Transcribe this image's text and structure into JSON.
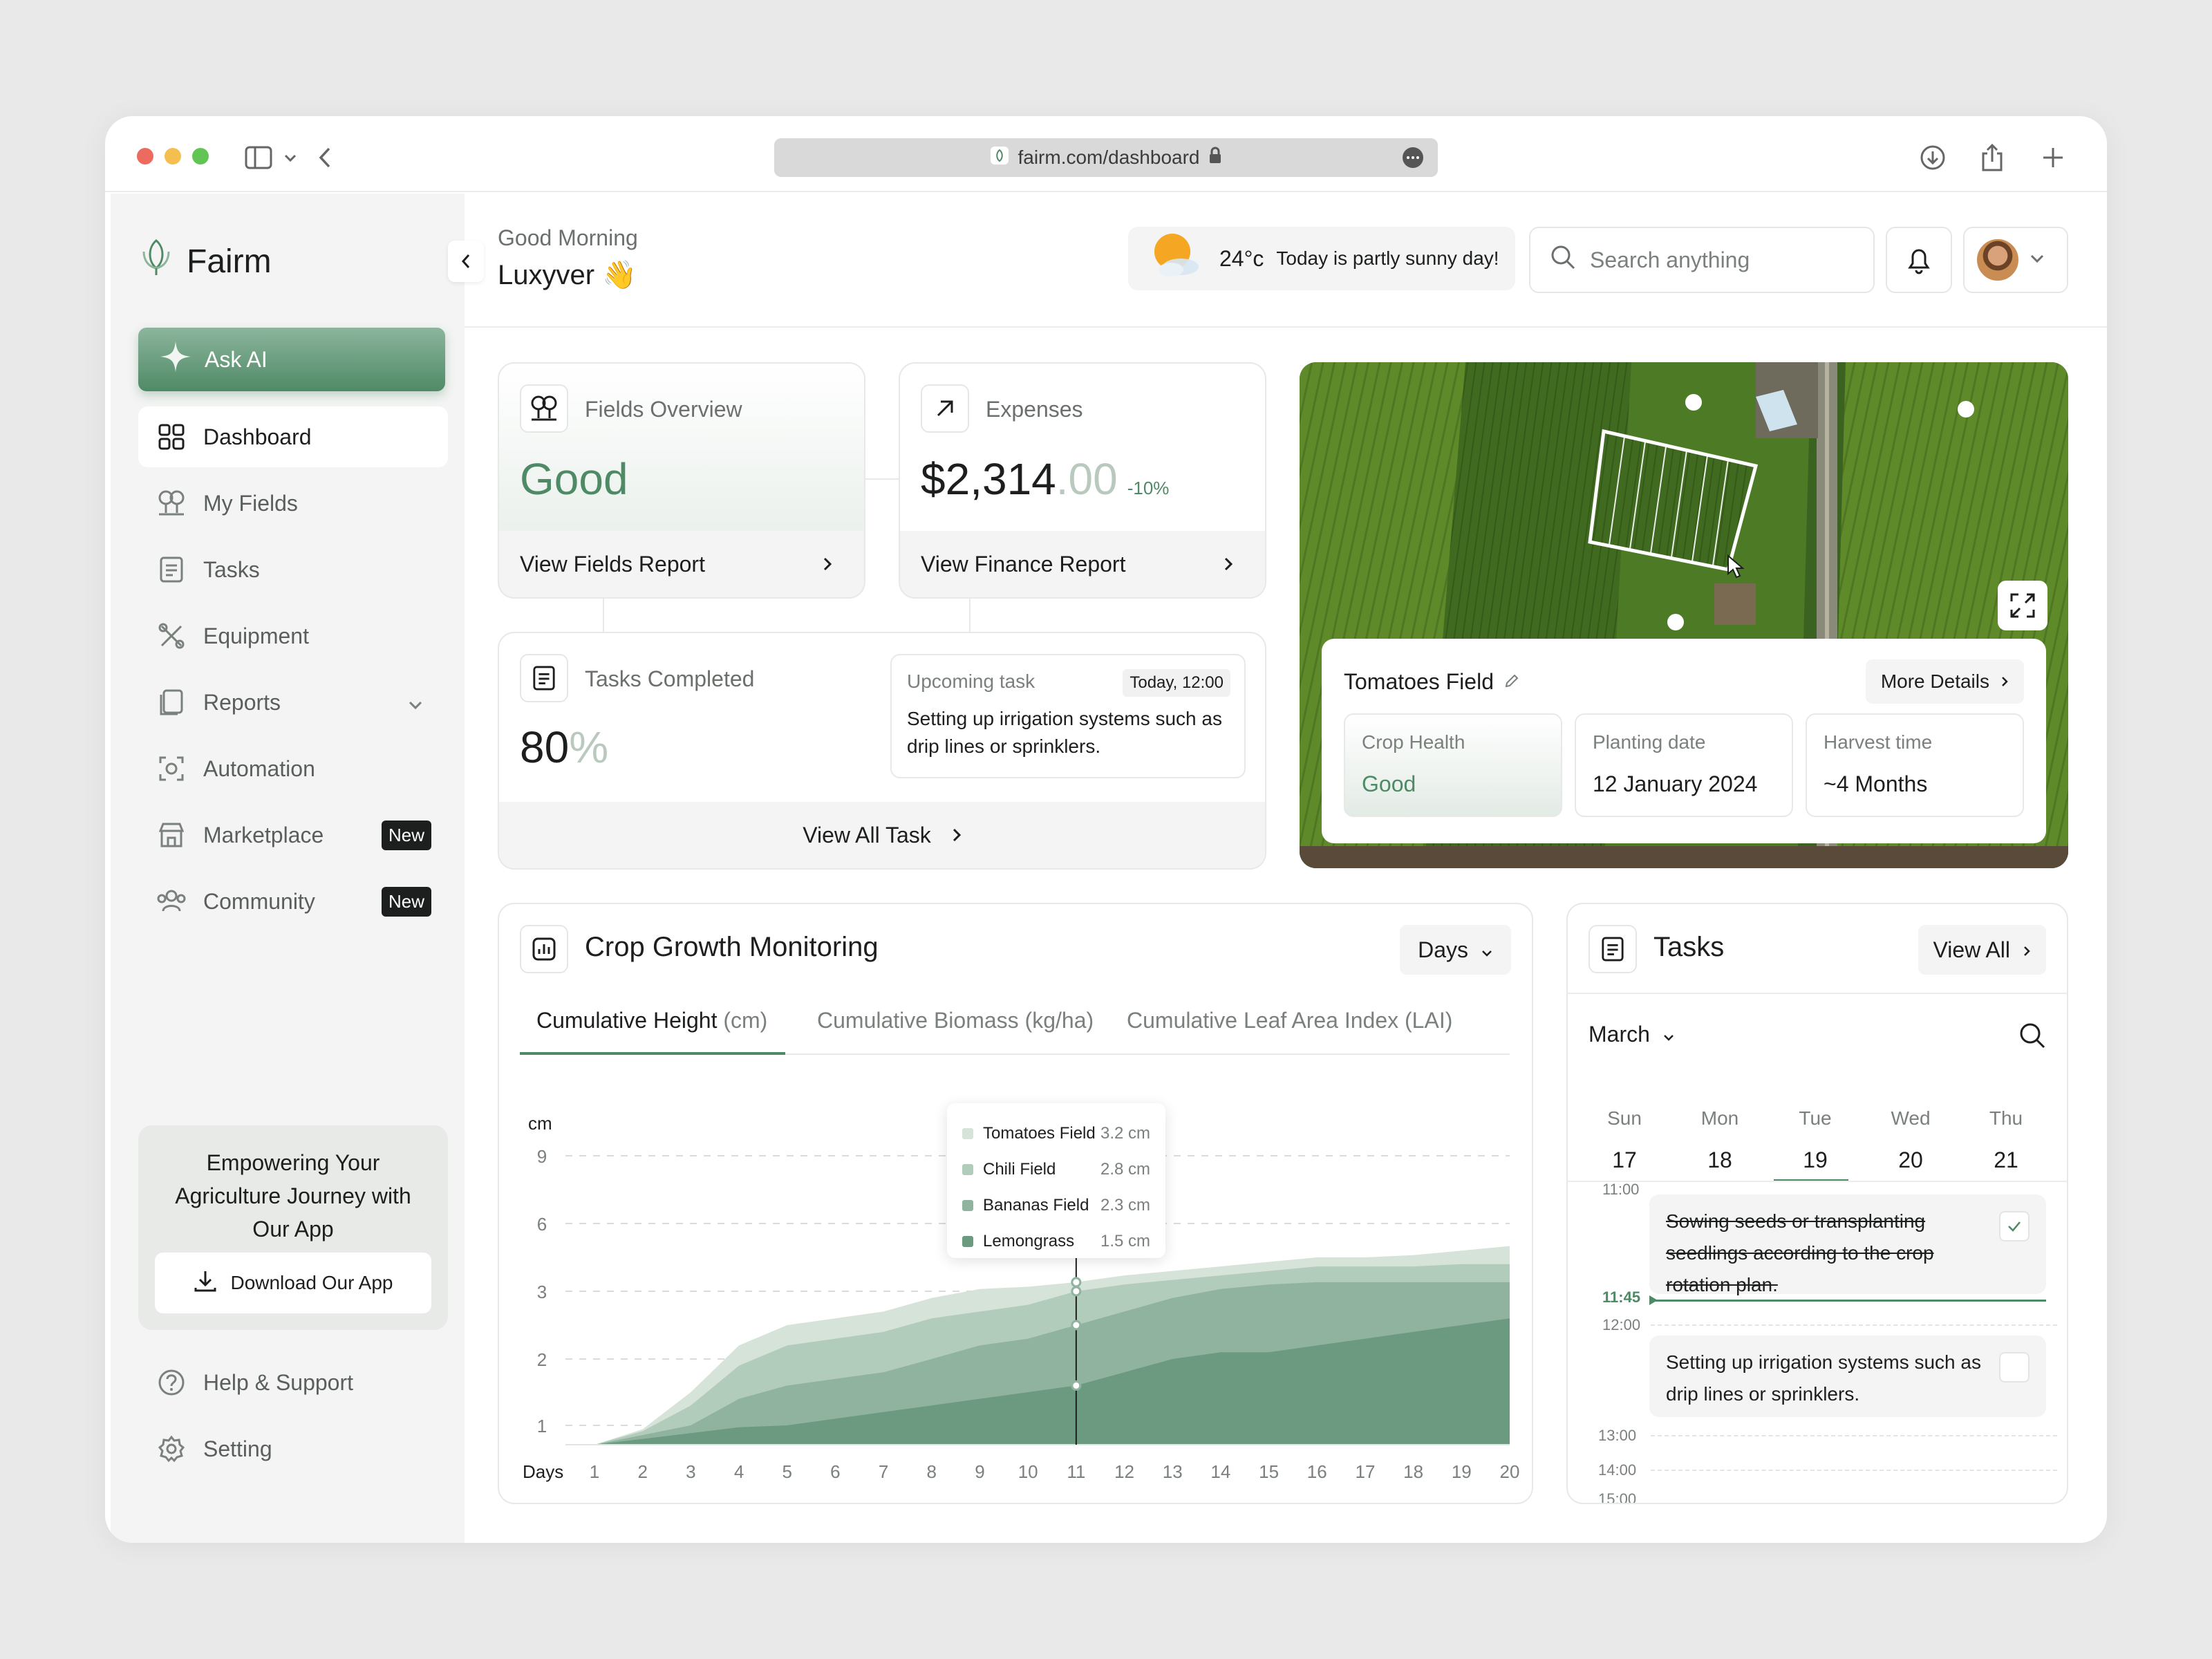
{
  "browser": {
    "url": "fairm.com/dashboard",
    "traffic_colors": [
      "#ed6a5e",
      "#f5bf4f",
      "#61c554"
    ]
  },
  "sidebar": {
    "brand": "Fairm",
    "ask_ai": "Ask AI",
    "items": [
      {
        "label": "Dashboard",
        "icon": "grid-icon",
        "active": true
      },
      {
        "label": "My Fields",
        "icon": "trees-icon"
      },
      {
        "label": "Tasks",
        "icon": "clipboard-icon"
      },
      {
        "label": "Equipment",
        "icon": "tools-icon"
      },
      {
        "label": "Reports",
        "icon": "reports-icon"
      },
      {
        "label": "Automation",
        "icon": "automation-icon"
      },
      {
        "label": "Marketplace",
        "icon": "store-icon",
        "badge": "New"
      },
      {
        "label": "Community",
        "icon": "users-icon",
        "badge": "New"
      }
    ],
    "promo": {
      "line1": "Empowering Your",
      "line2": "Agriculture Journey with",
      "line3": "Our App",
      "button": "Download Our App"
    },
    "help": "Help & Support",
    "setting": "Setting"
  },
  "header": {
    "greeting": "Good Morning",
    "name": "Luxyver 👋",
    "temperature": "24°c",
    "weather_text": "Today is partly sunny day!",
    "search_placeholder": "Search anything"
  },
  "fields_overview": {
    "title": "Fields Overview",
    "status": "Good",
    "link": "View Fields Report"
  },
  "expenses": {
    "title": "Expenses",
    "amount_main": "$2,314",
    "amount_cents": ".00",
    "change": "-10%",
    "link": "View Finance Report"
  },
  "tasks_completed": {
    "title": "Tasks Completed",
    "percent": "80",
    "percent_sign": "%",
    "upcoming_label": "Upcoming task",
    "upcoming_time": "Today, 12:00",
    "upcoming_text": "Setting up irrigation systems such as drip lines or sprinklers.",
    "link": "View All Task"
  },
  "field_detail": {
    "name": "Tomatoes Field",
    "more": "More Details",
    "crop_health_label": "Crop Health",
    "crop_health_value": "Good",
    "planting_label": "Planting date",
    "planting_value": "12 January 2024",
    "harvest_label": "Harvest time",
    "harvest_value": "~4 Months"
  },
  "crop_growth": {
    "title": "Crop Growth Monitoring",
    "period": "Days",
    "tabs": [
      {
        "label": "Cumulative Height",
        "unit": "(cm)",
        "active": true
      },
      {
        "label": "Cumulative Biomass (kg/ha)"
      },
      {
        "label": "Cumulative Leaf Area Index (LAI)"
      }
    ],
    "tooltip": [
      {
        "name": "Tomatoes Field",
        "value": "3.2 cm"
      },
      {
        "name": "Chili Field",
        "value": "2.8 cm"
      },
      {
        "name": "Bananas Field",
        "value": "2.3 cm"
      },
      {
        "name": "Lemongrass",
        "value": "1.5 cm"
      }
    ]
  },
  "chart_data": {
    "type": "area",
    "ylabel": "cm",
    "xlabel": "Days",
    "x": [
      1,
      2,
      3,
      4,
      5,
      6,
      7,
      8,
      9,
      10,
      11,
      12,
      13,
      14,
      15,
      16,
      17,
      18,
      19,
      20
    ],
    "y_ticks": [
      "1",
      "2",
      "3",
      "6",
      "9"
    ],
    "series": [
      {
        "name": "Tomatoes Field",
        "color": "#d5e3d9",
        "values": [
          0,
          0.8,
          1.5,
          2.2,
          2.5,
          2.6,
          2.7,
          2.9,
          3.1,
          3.2,
          3.4,
          3.7,
          3.9,
          4.1,
          4.3,
          4.5,
          4.5,
          4.6,
          4.8,
          5.0
        ]
      },
      {
        "name": "Chili Field",
        "color": "#b2ccbb",
        "values": [
          0,
          0.7,
          1.3,
          1.9,
          2.2,
          2.3,
          2.4,
          2.6,
          2.7,
          2.8,
          3.0,
          3.3,
          3.5,
          3.7,
          3.9,
          4.1,
          4.1,
          4.1,
          4.2,
          4.2
        ]
      },
      {
        "name": "Bananas Field",
        "color": "#8fb39e",
        "values": [
          0,
          0.5,
          1.0,
          1.4,
          1.6,
          1.7,
          1.8,
          2.0,
          2.2,
          2.3,
          2.5,
          2.7,
          2.9,
          3.1,
          3.3,
          3.4,
          3.4,
          3.4,
          3.4,
          3.4
        ]
      },
      {
        "name": "Lemongrass",
        "color": "#6b9a80",
        "values": [
          0,
          0.3,
          0.6,
          0.9,
          1.0,
          1.1,
          1.2,
          1.3,
          1.4,
          1.5,
          1.6,
          1.8,
          2.0,
          2.1,
          2.1,
          2.2,
          2.3,
          2.4,
          2.5,
          2.6
        ]
      }
    ],
    "highlight_x": 11
  },
  "tasks_panel": {
    "title": "Tasks",
    "view_all": "View All",
    "month": "March",
    "days": [
      {
        "name": "Sun",
        "date": "17"
      },
      {
        "name": "Mon",
        "date": "18"
      },
      {
        "name": "Tue",
        "date": "19",
        "active": true
      },
      {
        "name": "Wed",
        "date": "20"
      },
      {
        "name": "Thu",
        "date": "21"
      }
    ],
    "times": [
      "11:00",
      "11:45",
      "12:00",
      "13:00",
      "14:00",
      "15:00"
    ],
    "items": [
      {
        "text": "Sowing seeds or transplanting seedlings according to the crop rotation plan.",
        "done": true
      },
      {
        "text": "Setting up irrigation systems such as drip lines or sprinklers.",
        "done": false
      }
    ]
  }
}
